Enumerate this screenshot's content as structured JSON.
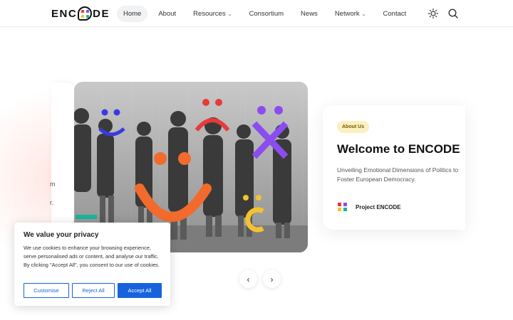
{
  "brand": {
    "logo_text_left": "ENC",
    "logo_text_right": "DE"
  },
  "nav": {
    "items": [
      {
        "label": "Home",
        "active": true
      },
      {
        "label": "About"
      },
      {
        "label": "Resources",
        "dropdown": true
      },
      {
        "label": "Consortium"
      },
      {
        "label": "News"
      },
      {
        "label": "Network",
        "dropdown": true
      },
      {
        "label": "Contact"
      }
    ],
    "icons": [
      "sun-icon",
      "search-icon"
    ]
  },
  "hero": {
    "back_card_text": [
      "m",
      "r."
    ],
    "card": {
      "badge": "About Us",
      "title": "Welcome to ENCODE",
      "subtitle": "Unveiling Emotional Dimensions of Politics to Foster European Democracy.",
      "author": "Project ENCODE"
    },
    "controls": {
      "prev": "‹",
      "next": "›"
    }
  },
  "cookie": {
    "title": "We value your privacy",
    "text": "We use cookies to enhance your browsing experience, serve personalised ads or content, and analyse our traffic. By clicking \"Accept All\", you consent to our use of cookies.",
    "buttons": {
      "customise": "Customise",
      "reject": "Reject All",
      "accept": "Accept All"
    }
  },
  "colors": {
    "accent_blue": "#1863dc",
    "badge_bg": "#fbf0c0",
    "orange": "#f26b2c",
    "purple": "#8b4cf0",
    "yellow": "#f2c230",
    "red": "#e83a3a",
    "teal": "#1ab39a"
  }
}
